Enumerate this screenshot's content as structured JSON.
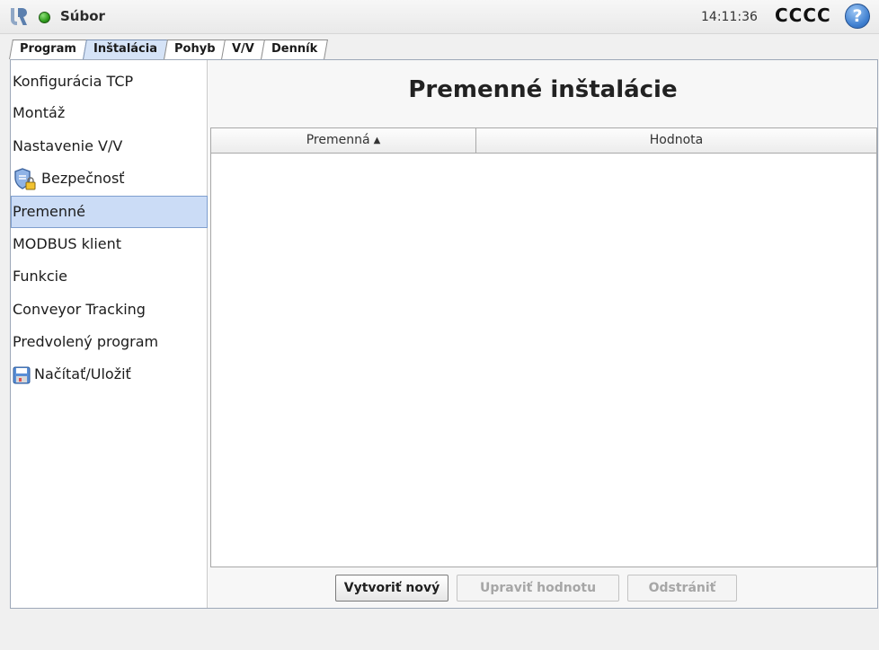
{
  "header": {
    "file_menu": "Súbor",
    "time": "14:11:36",
    "robot_name": "CCCC",
    "help_glyph": "?",
    "logo_icon": "ur-logo-icon",
    "status_icon": "status-green-dot-icon",
    "colors": {
      "status": "#2f9d1d",
      "help": "#3f7fd0"
    }
  },
  "tabs": [
    {
      "label": "Program",
      "active": false
    },
    {
      "label": "Inštalácia",
      "active": true
    },
    {
      "label": "Pohyb",
      "active": false
    },
    {
      "label": "V/V",
      "active": false
    },
    {
      "label": "Denník",
      "active": false
    }
  ],
  "sidebar": {
    "items": [
      {
        "label": "Konfigurácia TCP"
      },
      {
        "label": "Montáž"
      },
      {
        "label": "Nastavenie V/V"
      },
      {
        "label": "Bezpečnosť",
        "icon": "shield-lock-icon"
      },
      {
        "label": "Premenné",
        "selected": true
      },
      {
        "label": "MODBUS klient"
      },
      {
        "label": "Funkcie"
      },
      {
        "label": "Conveyor Tracking"
      },
      {
        "label": "Predvolený program"
      },
      {
        "label": "Načítať/Uložiť",
        "icon": "floppy-disk-icon"
      }
    ],
    "selected_color": "#cbdcf6"
  },
  "main": {
    "title": "Premenné inštalácie",
    "table": {
      "columns": [
        "Premenná",
        "Hodnota"
      ],
      "sort_indicator": "▲",
      "rows": []
    },
    "buttons": {
      "create": "Vytvoriť nový",
      "edit": "Upraviť hodnotu",
      "delete": "Odstrániť"
    }
  }
}
